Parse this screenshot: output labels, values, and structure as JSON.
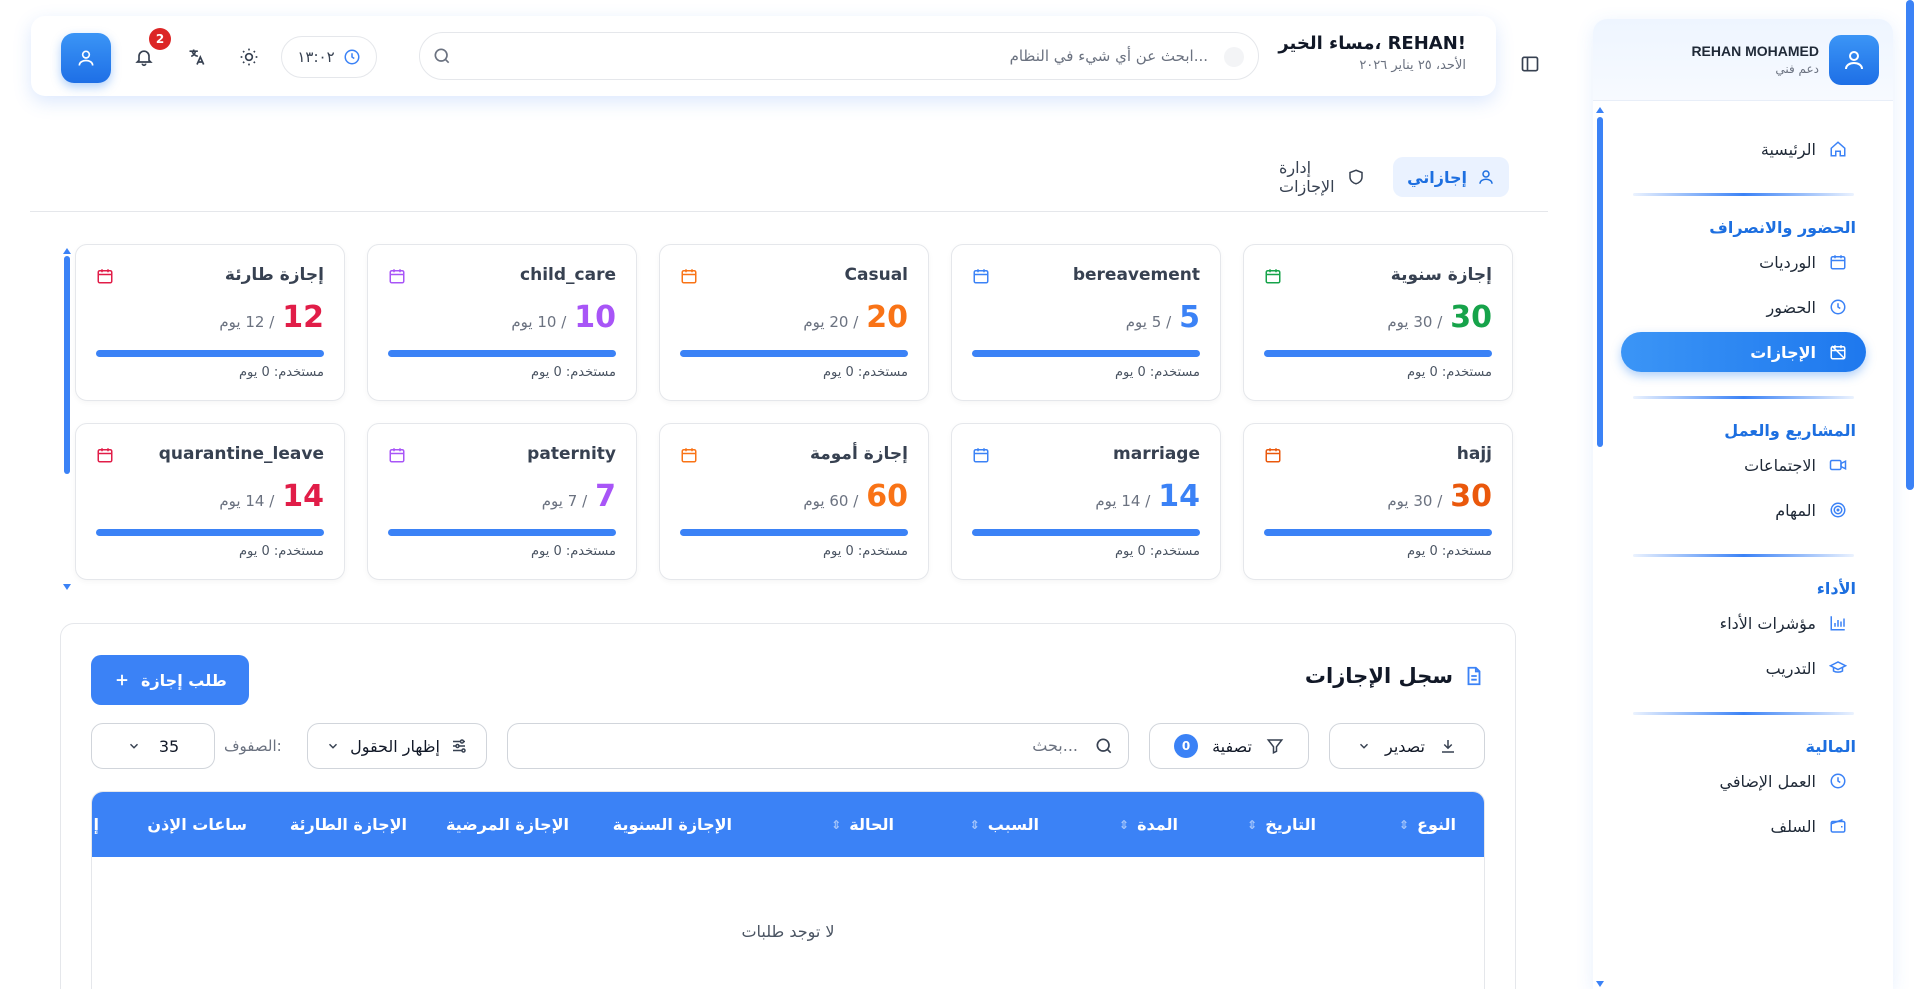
{
  "sidebar": {
    "user_name": "REHAN MOHAMED",
    "user_role": "دعم فني",
    "home": "الرئيسية",
    "sections": {
      "attendance": "الحضور والانصراف",
      "projects": "المشاريع والعمل",
      "performance": "الأداء",
      "finance": "المالية"
    },
    "items": {
      "shifts": "الورديات",
      "attendance": "الحضور",
      "leaves": "الإجازات",
      "meetings": "الاجتماعات",
      "tasks": "المهام",
      "kpis": "مؤشرات الأداء",
      "training": "التدريب",
      "overtime": "العمل الإضافي",
      "advances": "السلف"
    }
  },
  "header": {
    "greeting": "مساء الخير، REHAN!",
    "date": "الأحد، ٢٥ يناير ٢٠٢٦",
    "search_placeholder": "ابحث عن أي شيء في النظام...",
    "time": "١٣:٠٢",
    "notification_count": "2"
  },
  "tabs": {
    "my_leaves": "إجازاتي",
    "manage_leaves": "إدارة الإجازات"
  },
  "colors": {
    "primary": "#3b82f6",
    "green": "#16a34a",
    "blue": "#3b82f6",
    "orange": "#f97316",
    "purple": "#a855f7",
    "red": "#e11d48"
  },
  "leave_cards": [
    {
      "title": "إجازة سنوية",
      "value": "30",
      "of": "/ 30 يوم",
      "used": "مستخدم: 0 يوم",
      "color": "#16a34a",
      "used_fraction": 0
    },
    {
      "title": "bereavement",
      "value": "5",
      "of": "/ 5 يوم",
      "used": "مستخدم: 0 يوم",
      "color": "#3b82f6",
      "used_fraction": 0
    },
    {
      "title": "Casual",
      "value": "20",
      "of": "/ 20 يوم",
      "used": "مستخدم: 0 يوم",
      "color": "#f97316",
      "used_fraction": 0
    },
    {
      "title": "child_care",
      "value": "10",
      "of": "/ 10 يوم",
      "used": "مستخدم: 0 يوم",
      "color": "#a855f7",
      "used_fraction": 0
    },
    {
      "title": "إجازة طارئة",
      "value": "12",
      "of": "/ 12 يوم",
      "used": "مستخدم: 0 يوم",
      "color": "#e11d48",
      "used_fraction": 0
    },
    {
      "title": "hajj",
      "value": "30",
      "of": "/ 30 يوم",
      "used": "مستخدم: 0 يوم",
      "color": "#ea580c",
      "used_fraction": 0
    },
    {
      "title": "marriage",
      "value": "14",
      "of": "/ 14 يوم",
      "used": "مستخدم: 0 يوم",
      "color": "#3b82f6",
      "used_fraction": 0
    },
    {
      "title": "إجازة أمومة",
      "value": "60",
      "of": "/ 60 يوم",
      "used": "مستخدم: 0 يوم",
      "color": "#f97316",
      "used_fraction": 0
    },
    {
      "title": "paternity",
      "value": "7",
      "of": "/ 7 يوم",
      "used": "مستخدم: 0 يوم",
      "color": "#a855f7",
      "used_fraction": 0
    },
    {
      "title": "quarantine_leave",
      "value": "14",
      "of": "/ 14 يوم",
      "used": "مستخدم: 0 يوم",
      "color": "#e11d48",
      "used_fraction": 0
    }
  ],
  "records": {
    "title": "سجل الإجازات",
    "request_button": "طلب إجازة",
    "export": "تصدير",
    "filter": "تصفية",
    "filter_count": "0",
    "search_placeholder": "بحث...",
    "show_fields": "إظهار الحقول",
    "rows_label": "الصفوف:",
    "rows_value": "35",
    "columns": [
      "النوع",
      "التاريخ",
      "المدة",
      "السبب",
      "الحالة",
      "الإجازة السنوية",
      "الإجازة المرضية",
      "الإجازة الطارئة",
      "ساعات الإذن",
      "إ"
    ],
    "empty": "لا توجد طلبات"
  }
}
